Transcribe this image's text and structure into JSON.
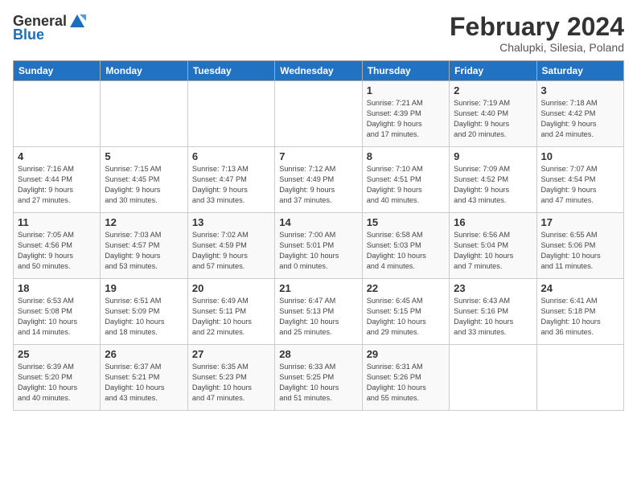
{
  "header": {
    "logo_general": "General",
    "logo_blue": "Blue",
    "month_year": "February 2024",
    "location": "Chalupki, Silesia, Poland"
  },
  "days_of_week": [
    "Sunday",
    "Monday",
    "Tuesday",
    "Wednesday",
    "Thursday",
    "Friday",
    "Saturday"
  ],
  "weeks": [
    [
      {
        "day": "",
        "info": ""
      },
      {
        "day": "",
        "info": ""
      },
      {
        "day": "",
        "info": ""
      },
      {
        "day": "",
        "info": ""
      },
      {
        "day": "1",
        "info": "Sunrise: 7:21 AM\nSunset: 4:39 PM\nDaylight: 9 hours\nand 17 minutes."
      },
      {
        "day": "2",
        "info": "Sunrise: 7:19 AM\nSunset: 4:40 PM\nDaylight: 9 hours\nand 20 minutes."
      },
      {
        "day": "3",
        "info": "Sunrise: 7:18 AM\nSunset: 4:42 PM\nDaylight: 9 hours\nand 24 minutes."
      }
    ],
    [
      {
        "day": "4",
        "info": "Sunrise: 7:16 AM\nSunset: 4:44 PM\nDaylight: 9 hours\nand 27 minutes."
      },
      {
        "day": "5",
        "info": "Sunrise: 7:15 AM\nSunset: 4:45 PM\nDaylight: 9 hours\nand 30 minutes."
      },
      {
        "day": "6",
        "info": "Sunrise: 7:13 AM\nSunset: 4:47 PM\nDaylight: 9 hours\nand 33 minutes."
      },
      {
        "day": "7",
        "info": "Sunrise: 7:12 AM\nSunset: 4:49 PM\nDaylight: 9 hours\nand 37 minutes."
      },
      {
        "day": "8",
        "info": "Sunrise: 7:10 AM\nSunset: 4:51 PM\nDaylight: 9 hours\nand 40 minutes."
      },
      {
        "day": "9",
        "info": "Sunrise: 7:09 AM\nSunset: 4:52 PM\nDaylight: 9 hours\nand 43 minutes."
      },
      {
        "day": "10",
        "info": "Sunrise: 7:07 AM\nSunset: 4:54 PM\nDaylight: 9 hours\nand 47 minutes."
      }
    ],
    [
      {
        "day": "11",
        "info": "Sunrise: 7:05 AM\nSunset: 4:56 PM\nDaylight: 9 hours\nand 50 minutes."
      },
      {
        "day": "12",
        "info": "Sunrise: 7:03 AM\nSunset: 4:57 PM\nDaylight: 9 hours\nand 53 minutes."
      },
      {
        "day": "13",
        "info": "Sunrise: 7:02 AM\nSunset: 4:59 PM\nDaylight: 9 hours\nand 57 minutes."
      },
      {
        "day": "14",
        "info": "Sunrise: 7:00 AM\nSunset: 5:01 PM\nDaylight: 10 hours\nand 0 minutes."
      },
      {
        "day": "15",
        "info": "Sunrise: 6:58 AM\nSunset: 5:03 PM\nDaylight: 10 hours\nand 4 minutes."
      },
      {
        "day": "16",
        "info": "Sunrise: 6:56 AM\nSunset: 5:04 PM\nDaylight: 10 hours\nand 7 minutes."
      },
      {
        "day": "17",
        "info": "Sunrise: 6:55 AM\nSunset: 5:06 PM\nDaylight: 10 hours\nand 11 minutes."
      }
    ],
    [
      {
        "day": "18",
        "info": "Sunrise: 6:53 AM\nSunset: 5:08 PM\nDaylight: 10 hours\nand 14 minutes."
      },
      {
        "day": "19",
        "info": "Sunrise: 6:51 AM\nSunset: 5:09 PM\nDaylight: 10 hours\nand 18 minutes."
      },
      {
        "day": "20",
        "info": "Sunrise: 6:49 AM\nSunset: 5:11 PM\nDaylight: 10 hours\nand 22 minutes."
      },
      {
        "day": "21",
        "info": "Sunrise: 6:47 AM\nSunset: 5:13 PM\nDaylight: 10 hours\nand 25 minutes."
      },
      {
        "day": "22",
        "info": "Sunrise: 6:45 AM\nSunset: 5:15 PM\nDaylight: 10 hours\nand 29 minutes."
      },
      {
        "day": "23",
        "info": "Sunrise: 6:43 AM\nSunset: 5:16 PM\nDaylight: 10 hours\nand 33 minutes."
      },
      {
        "day": "24",
        "info": "Sunrise: 6:41 AM\nSunset: 5:18 PM\nDaylight: 10 hours\nand 36 minutes."
      }
    ],
    [
      {
        "day": "25",
        "info": "Sunrise: 6:39 AM\nSunset: 5:20 PM\nDaylight: 10 hours\nand 40 minutes."
      },
      {
        "day": "26",
        "info": "Sunrise: 6:37 AM\nSunset: 5:21 PM\nDaylight: 10 hours\nand 43 minutes."
      },
      {
        "day": "27",
        "info": "Sunrise: 6:35 AM\nSunset: 5:23 PM\nDaylight: 10 hours\nand 47 minutes."
      },
      {
        "day": "28",
        "info": "Sunrise: 6:33 AM\nSunset: 5:25 PM\nDaylight: 10 hours\nand 51 minutes."
      },
      {
        "day": "29",
        "info": "Sunrise: 6:31 AM\nSunset: 5:26 PM\nDaylight: 10 hours\nand 55 minutes."
      },
      {
        "day": "",
        "info": ""
      },
      {
        "day": "",
        "info": ""
      }
    ]
  ]
}
